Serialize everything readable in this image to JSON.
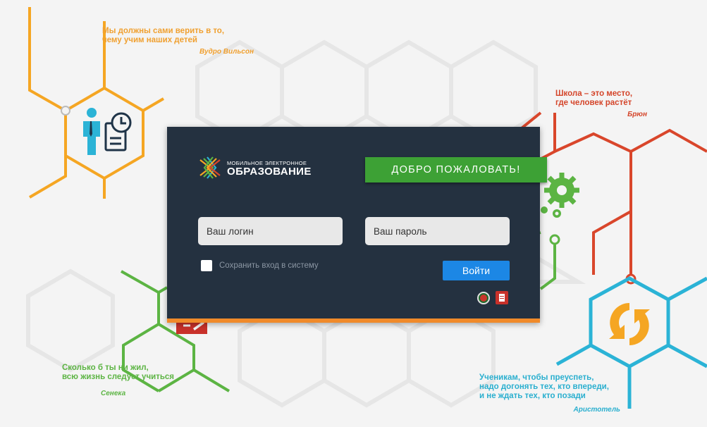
{
  "quotes": {
    "orange": {
      "line1": "Мы должны сами верить в то,",
      "line2": "чему учим наших детей",
      "author": "Вудро Вильсон"
    },
    "red": {
      "line1": "Школа – это место,",
      "line2": "где человек растёт",
      "author": "Брюн"
    },
    "green": {
      "line1": "Сколько б ты ни жил,",
      "line2": "всю жизнь следует учиться",
      "author": "Сенека"
    },
    "blue": {
      "line1": "Ученикам, чтобы преуспеть,",
      "line2": "надо догонять тех, кто впереди,",
      "line3": "и не ждать тех, кто позади",
      "author": "Аристотель"
    }
  },
  "logo": {
    "small": "МОБИЛЬНОЕ ЭЛЕКТРОННОЕ",
    "big": "ОБРАЗОВАНИЕ"
  },
  "welcome_label": "ДОБРО ПОЖАЛОВАТЬ!",
  "login": {
    "placeholder": "Ваш логин",
    "value": ""
  },
  "password": {
    "placeholder": "Ваш пароль",
    "value": ""
  },
  "remember_label": "Сохранить вход в систему",
  "submit_label": "Войти",
  "icons": {
    "orange_hex": "person-clock-icon",
    "red_hex": "gears-icon",
    "green_hex": "document-pencil-icon",
    "blue_hex": "refresh-arrows-icon",
    "badge_left": "emblem-icon",
    "badge_right": "document-icon"
  },
  "colors": {
    "orange": "#f5a623",
    "red": "#d9462b",
    "green": "#5cb443",
    "blue": "#2bb3d6",
    "panel": "#243140",
    "welcome": "#3da135",
    "submit": "#1c87e5",
    "accent_bottom": "#f08a2a"
  }
}
